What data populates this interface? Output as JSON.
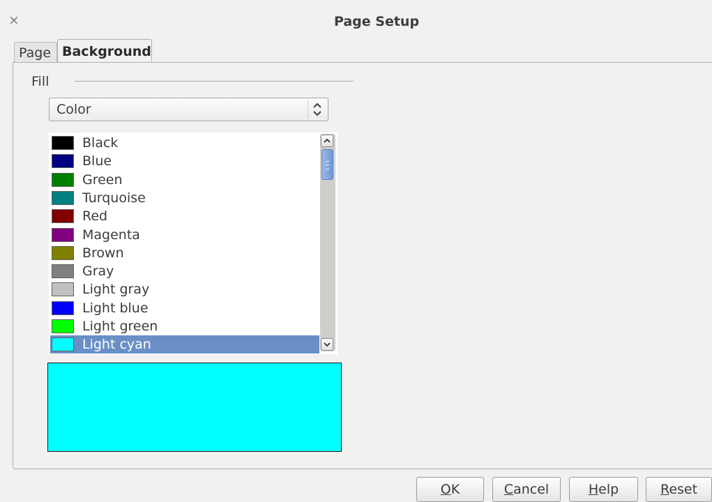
{
  "window": {
    "title": "Page Setup",
    "close_symbol": "×"
  },
  "tabs": [
    {
      "label": "Page",
      "active": false
    },
    {
      "label": "Background",
      "active": true
    }
  ],
  "fill": {
    "section_label": "Fill",
    "type_select": {
      "value": "Color"
    }
  },
  "color_list": {
    "items": [
      {
        "label": "Black",
        "color": "#000000"
      },
      {
        "label": "Blue",
        "color": "#000080"
      },
      {
        "label": "Green",
        "color": "#008000"
      },
      {
        "label": "Turquoise",
        "color": "#008080"
      },
      {
        "label": "Red",
        "color": "#800000"
      },
      {
        "label": "Magenta",
        "color": "#800080"
      },
      {
        "label": "Brown",
        "color": "#808000"
      },
      {
        "label": "Gray",
        "color": "#808080"
      },
      {
        "label": "Light gray",
        "color": "#c0c0c0"
      },
      {
        "label": "Light blue",
        "color": "#0000ff"
      },
      {
        "label": "Light green",
        "color": "#00ff00"
      },
      {
        "label": "Light cyan",
        "color": "#00ffff"
      }
    ],
    "selected_index": 11
  },
  "preview": {
    "color": "#00ffff"
  },
  "buttons": {
    "ok": {
      "mnemonic": "O",
      "rest": "K"
    },
    "cancel": {
      "mnemonic": "C",
      "rest": "ancel"
    },
    "help": {
      "mnemonic": "H",
      "rest": "elp"
    },
    "reset": {
      "mnemonic": "R",
      "rest": "eset"
    }
  },
  "colors": {
    "selection": "#6a8fc6",
    "window_bg": "#f2f1f0"
  }
}
